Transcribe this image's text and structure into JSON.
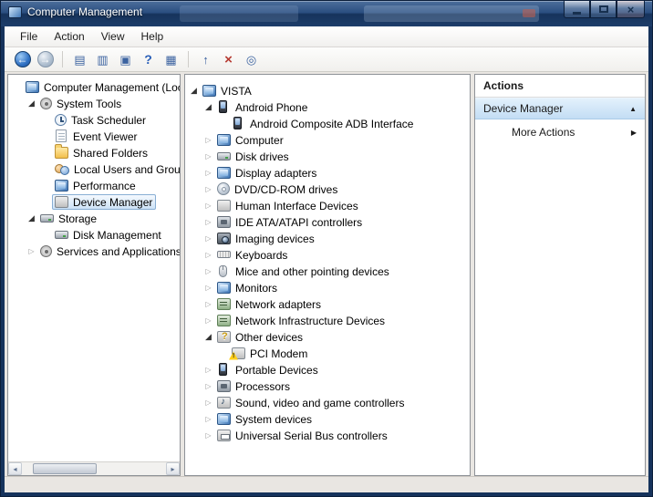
{
  "window": {
    "title": "Computer Management"
  },
  "menu": {
    "items": [
      "File",
      "Action",
      "View",
      "Help"
    ]
  },
  "toolbar": {
    "buttons": [
      "back",
      "forward",
      "separator",
      "show-console-tree",
      "export-list",
      "properties",
      "help",
      "show-action-pane",
      "separator",
      "update-driver",
      "uninstall",
      "scan-hardware"
    ]
  },
  "console_tree": {
    "items": [
      {
        "label": "Computer Management (Local",
        "icon": "computer-management",
        "level": 0,
        "state": "none"
      },
      {
        "label": "System Tools",
        "icon": "system-tools",
        "level": 1,
        "state": "expanded"
      },
      {
        "label": "Task Scheduler",
        "icon": "task-scheduler",
        "level": 2,
        "state": "none"
      },
      {
        "label": "Event Viewer",
        "icon": "event-viewer",
        "level": 2,
        "state": "none"
      },
      {
        "label": "Shared Folders",
        "icon": "shared-folders",
        "level": 2,
        "state": "none"
      },
      {
        "label": "Local Users and Groups",
        "icon": "local-users-and-groups",
        "level": 2,
        "state": "none"
      },
      {
        "label": "Performance",
        "icon": "performance",
        "level": 2,
        "state": "none"
      },
      {
        "label": "Device Manager",
        "icon": "device-manager",
        "level": 2,
        "state": "none",
        "selected": true
      },
      {
        "label": "Storage",
        "icon": "storage",
        "level": 1,
        "state": "expanded"
      },
      {
        "label": "Disk Management",
        "icon": "disk-management",
        "level": 2,
        "state": "none"
      },
      {
        "label": "Services and Applications",
        "icon": "services-and-applications",
        "level": 1,
        "state": "collapsed"
      }
    ]
  },
  "device_tree": {
    "items": [
      {
        "label": "VISTA",
        "icon": "computer",
        "level": 0,
        "state": "expanded"
      },
      {
        "label": "Android Phone",
        "icon": "android-phone",
        "level": 1,
        "state": "expanded"
      },
      {
        "label": "Android Composite ADB Interface",
        "icon": "adb-interface",
        "level": 2,
        "state": "none"
      },
      {
        "label": "Computer",
        "icon": "computer-node",
        "level": 1,
        "state": "collapsed"
      },
      {
        "label": "Disk drives",
        "icon": "disk-drives",
        "level": 1,
        "state": "collapsed"
      },
      {
        "label": "Display adapters",
        "icon": "display-adapters",
        "level": 1,
        "state": "collapsed"
      },
      {
        "label": "DVD/CD-ROM drives",
        "icon": "dvd-cd-rom-drives",
        "level": 1,
        "state": "collapsed"
      },
      {
        "label": "Human Interface Devices",
        "icon": "human-interface-devices",
        "level": 1,
        "state": "collapsed"
      },
      {
        "label": "IDE ATA/ATAPI controllers",
        "icon": "ide-ata-atapi-controllers",
        "level": 1,
        "state": "collapsed"
      },
      {
        "label": "Imaging devices",
        "icon": "imaging-devices",
        "level": 1,
        "state": "collapsed"
      },
      {
        "label": "Keyboards",
        "icon": "keyboards",
        "level": 1,
        "state": "collapsed"
      },
      {
        "label": "Mice and other pointing devices",
        "icon": "mice",
        "level": 1,
        "state": "collapsed"
      },
      {
        "label": "Monitors",
        "icon": "monitors",
        "level": 1,
        "state": "collapsed"
      },
      {
        "label": "Network adapters",
        "icon": "network-adapters",
        "level": 1,
        "state": "collapsed"
      },
      {
        "label": "Network Infrastructure Devices",
        "icon": "network-infrastructure-devices",
        "level": 1,
        "state": "collapsed"
      },
      {
        "label": "Other devices",
        "icon": "other-devices",
        "level": 1,
        "state": "expanded"
      },
      {
        "label": "PCI Modem",
        "icon": "pci-modem",
        "level": 2,
        "state": "none",
        "warning": true
      },
      {
        "label": "Portable Devices",
        "icon": "portable-devices",
        "level": 1,
        "state": "collapsed"
      },
      {
        "label": "Processors",
        "icon": "processors",
        "level": 1,
        "state": "collapsed"
      },
      {
        "label": "Sound, video and game controllers",
        "icon": "sound-video-game-controllers",
        "level": 1,
        "state": "collapsed"
      },
      {
        "label": "System devices",
        "icon": "system-devices",
        "level": 1,
        "state": "collapsed"
      },
      {
        "label": "Universal Serial Bus controllers",
        "icon": "usb-controllers",
        "level": 1,
        "state": "collapsed"
      }
    ]
  },
  "actions": {
    "header": "Actions",
    "items": [
      {
        "label": "Device Manager",
        "selected": true
      },
      {
        "label": "More Actions"
      }
    ]
  },
  "colors": {
    "titlebar_blue": "#2a4e80",
    "selection_fill": "#cde2f6",
    "selection_border": "#88aed4",
    "action_highlight": "#c3ddf4",
    "warning_yellow": "#ffcf1a"
  }
}
